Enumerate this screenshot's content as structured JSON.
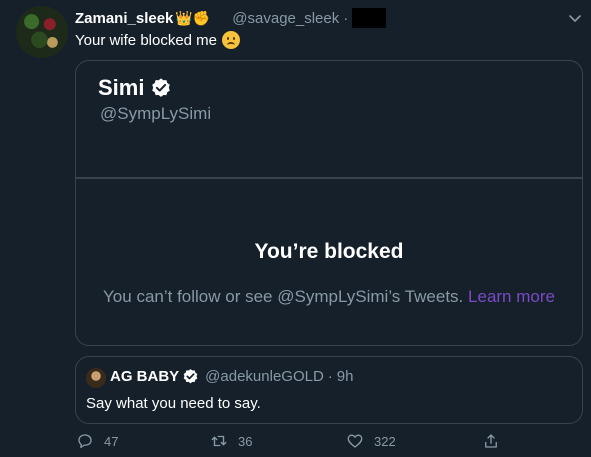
{
  "author": {
    "display_name": "Zamani_sleek",
    "name_emojis": "👑✊",
    "handle": "@savage_sleek",
    "separator": "·"
  },
  "tweet": {
    "text": "Your wife blocked me"
  },
  "blocked_card": {
    "name": "Simi",
    "handle": "@SympLySimi",
    "title": "You’re blocked",
    "message": "You can’t follow or see @SympLySimi’s Tweets.",
    "link_text": "Learn more"
  },
  "quoted_tweet": {
    "name": "AG BABY",
    "handle": "@adekunleGOLD",
    "separator": "·",
    "time": "9h",
    "text": "Say what you need to say."
  },
  "actions": {
    "reply_count": "47",
    "retweet_count": "36",
    "like_count": "322"
  },
  "colors": {
    "background": "#15202b",
    "border": "#38444d",
    "muted": "#8899a6",
    "link": "#794bc4"
  }
}
